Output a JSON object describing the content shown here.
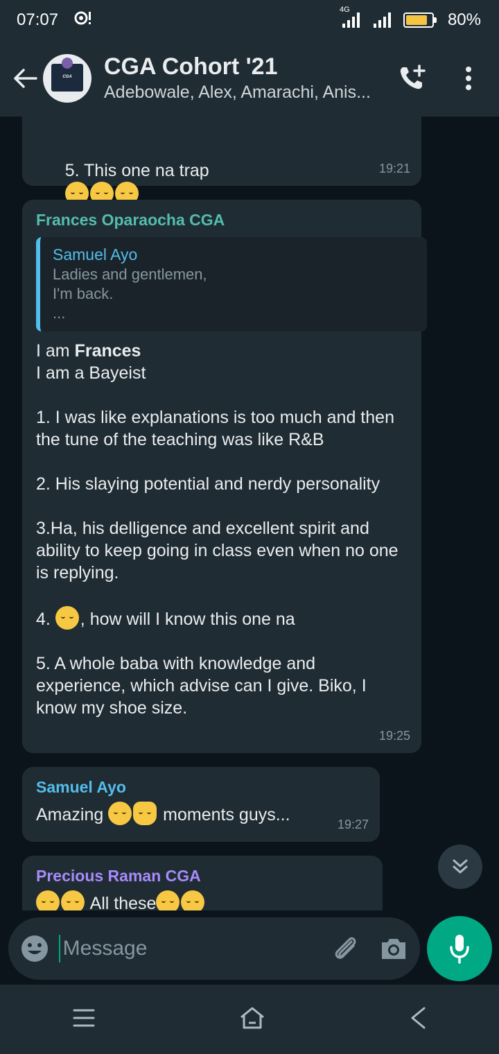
{
  "status_bar": {
    "time": "07:07",
    "network": "4G",
    "battery": "80%"
  },
  "header": {
    "title": "CGA Cohort '21",
    "subtitle": "Adebowale, Alex, Amarachi, Anis..."
  },
  "messages": [
    {
      "text": "5. This one na trap",
      "time": "19:21"
    },
    {
      "sender": "Frances Oparaocha CGA",
      "sender_color": "#53bdae",
      "quote": {
        "name": "Samuel Ayo",
        "text": "Ladies and gentlemen,\nI'm back.\n..."
      },
      "text_before_bold": "I am ",
      "bold": "Frances",
      "text_after_bold": "\nI am a Bayeist\n\n1. I was like explanations is too much and then the tune of the teaching was like R&B\n\n2. His slaying potential and nerdy personality\n\n3.Ha, his delligence and excellent spirit and ability to keep going in class even when no one is replying.\n\n4. ",
      "line4_after_emoji": ", how will I know this one na",
      "final": "5. A whole baba with knowledge and experience, which advise can I give. Biko, I know my shoe size.",
      "time": "19:25"
    },
    {
      "sender": "Samuel Ayo",
      "sender_color": "#53bdeb",
      "text_start": "Amazing ",
      "text_end": " moments guys...",
      "time": "19:27"
    },
    {
      "sender": "Precious Raman CGA",
      "sender_color": "#a78bfa",
      "text": " All these"
    }
  ],
  "composer": {
    "placeholder": "Message"
  },
  "icons": {
    "back": "arrow-left-icon",
    "call": "add-call-icon",
    "menu": "more-vert-icon",
    "emoji": "emoji-icon",
    "attach": "paperclip-icon",
    "camera": "camera-icon",
    "mic": "microphone-icon",
    "scroll": "double-chevron-down-icon"
  },
  "colors": {
    "accent": "#00a884",
    "bubble": "#202c33",
    "header": "#1f2c34"
  }
}
